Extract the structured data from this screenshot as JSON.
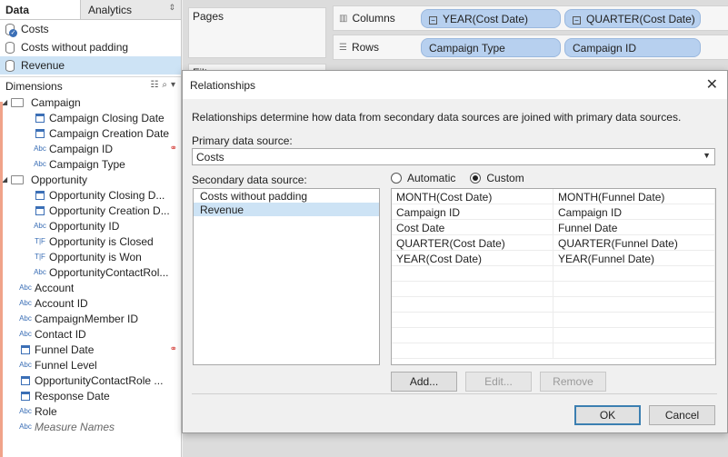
{
  "left_pane": {
    "tabs": {
      "data": "Data",
      "analytics": "Analytics",
      "updown": "⇕"
    },
    "data_sources": [
      {
        "name": "Costs",
        "primary": true
      },
      {
        "name": "Costs without padding",
        "primary": false
      },
      {
        "name": "Revenue",
        "primary": false,
        "selected": true
      }
    ],
    "dimensions_header": "Dimensions",
    "campaign_folder": "Campaign",
    "campaign_fields": [
      {
        "label": "Campaign Closing Date",
        "type": "date"
      },
      {
        "label": "Campaign Creation Date",
        "type": "date"
      },
      {
        "label": "Campaign ID",
        "type": "string",
        "link": true
      },
      {
        "label": "Campaign Type",
        "type": "string"
      }
    ],
    "opportunity_folder": "Opportunity",
    "opportunity_fields": [
      {
        "label": "Opportunity Closing D...",
        "type": "date"
      },
      {
        "label": "Opportunity Creation D...",
        "type": "date"
      },
      {
        "label": "Opportunity ID",
        "type": "string"
      },
      {
        "label": "Opportunity is Closed",
        "type": "boolean"
      },
      {
        "label": "Opportunity is Won",
        "type": "boolean"
      },
      {
        "label": "OpportunityContactRol...",
        "type": "string"
      }
    ],
    "other_fields": [
      {
        "label": "Account",
        "type": "string"
      },
      {
        "label": "Account ID",
        "type": "string"
      },
      {
        "label": "CampaignMember ID",
        "type": "string"
      },
      {
        "label": "Contact ID",
        "type": "string"
      },
      {
        "label": "Funnel Date",
        "type": "date",
        "link": true
      },
      {
        "label": "Funnel Level",
        "type": "string"
      },
      {
        "label": "OpportunityContactRole ...",
        "type": "date"
      },
      {
        "label": "Response Date",
        "type": "date"
      },
      {
        "label": "Role",
        "type": "string"
      },
      {
        "label": "Measure Names",
        "type": "string",
        "italic": true
      }
    ],
    "type_glyphs": {
      "string": "Abc",
      "boolean": "T|F"
    }
  },
  "workspace": {
    "pages_label": "Pages",
    "columns_label": "Columns",
    "rows_label": "Rows",
    "columns_pills": [
      "YEAR(Cost Date)",
      "QUARTER(Cost Date)"
    ],
    "rows_pills": [
      "Campaign Type",
      "Campaign ID"
    ],
    "filters_stub": "Filt"
  },
  "dialog": {
    "title": "Relationships",
    "close": "✕",
    "description": "Relationships determine how data from secondary data sources are joined with primary data sources.",
    "primary_label": "Primary data source:",
    "primary_value": "Costs",
    "secondary_label": "Secondary data source:",
    "secondary_items": [
      "Costs without padding",
      "Revenue"
    ],
    "secondary_selected": 1,
    "radio_automatic": "Automatic",
    "radio_custom": "Custom",
    "mappings": [
      [
        "MONTH(Cost Date)",
        "MONTH(Funnel Date)"
      ],
      [
        "Campaign ID",
        "Campaign ID"
      ],
      [
        "Cost Date",
        "Funnel Date"
      ],
      [
        "QUARTER(Cost Date)",
        "QUARTER(Funnel Date)"
      ],
      [
        "YEAR(Cost Date)",
        "YEAR(Funnel Date)"
      ]
    ],
    "add_button": "Add...",
    "edit_button": "Edit...",
    "remove_button": "Remove",
    "ok_button": "OK",
    "cancel_button": "Cancel"
  }
}
